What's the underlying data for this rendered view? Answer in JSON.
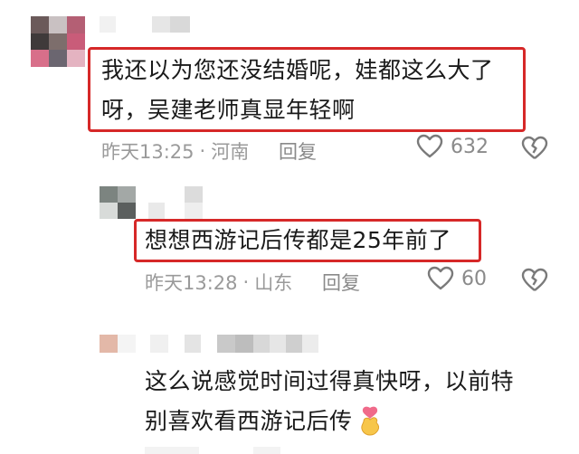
{
  "comments": [
    {
      "text_line1": "我还以为您还没结婚呢，娃都这么大了",
      "text_line2": "呀，吴建老师真显年轻啊",
      "time": "昨天13:25",
      "location": "河南",
      "reply_label": "回复",
      "likes": "632"
    },
    {
      "text_line1": "想想西游记后传都是25年前了",
      "time": "昨天13:28",
      "location": "山东",
      "reply_label": "回复",
      "likes": "60"
    },
    {
      "text_line1": "这么说感觉时间过得真快呀，以前特",
      "text_line2": "别喜欢看西游记后传",
      "emoji": "finger-heart"
    }
  ],
  "separator": "·",
  "colors": {
    "highlight": "#d62828",
    "text": "#1a1a1a",
    "meta": "#9a9a9a",
    "icon": "#7a7a7a"
  },
  "icons": [
    "heart-outline-icon",
    "broken-heart-icon",
    "finger-heart-emoji"
  ]
}
